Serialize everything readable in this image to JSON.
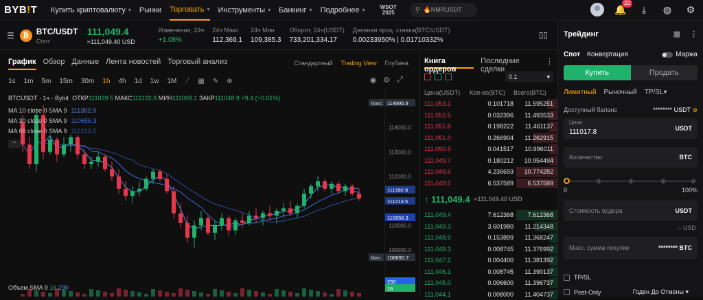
{
  "nav": {
    "logo_a": "BYB",
    "logo_b": "!",
    "logo_c": "T",
    "items": [
      {
        "label": "Купить криптовалюту",
        "chev": true
      },
      {
        "label": "Рынки",
        "chev": false
      },
      {
        "label": "Торговать",
        "chev": true,
        "active": true
      },
      {
        "label": "Инструменты",
        "chev": true
      },
      {
        "label": "Банкинг",
        "chev": true
      },
      {
        "label": "Подробнее",
        "chev": true
      }
    ],
    "wsot_a": "WSOT",
    "wsot_b": "2025",
    "search_placeholder": "🔥NMRUSDT",
    "notif_count": "22"
  },
  "ticker": {
    "pair": "BTC/USDT",
    "market": "Спот",
    "last": "111,049.4",
    "last_usd": "≈111,049.40 USD",
    "stats": [
      {
        "label": "Изменение, 24ч",
        "value": "+1.08%",
        "green": true
      },
      {
        "label": "24ч Макс",
        "value": "112,369.1"
      },
      {
        "label": "24ч Мин",
        "value": "109,385.3"
      },
      {
        "label": "Оборот, 24ч(USDT)",
        "value": "733,201,334.17"
      },
      {
        "label": "Дневная проц. ставка(BTC/USDT)",
        "value": "0.00233950% | 0.01710332%"
      }
    ]
  },
  "chart_tabs": [
    "График",
    "Обзор",
    "Данные",
    "Лента новостей",
    "Торговый анализ"
  ],
  "view_tabs": [
    "Стандартный",
    "Trading View",
    "Глубина"
  ],
  "timeframes": [
    "1s",
    "1m",
    "5m",
    "15m",
    "30m",
    "1h",
    "4h",
    "1d",
    "1w",
    "1M"
  ],
  "ohlc": {
    "symbol": "BTCUSDT · 1ч · Bybit",
    "o_l": "ОТКР",
    "o": "111039.5",
    "h_l": "МАКС",
    "h": "111132.8",
    "l_l": "МИН",
    "l": "111008.1",
    "c_l": "ЗАКР",
    "c": "111048.9",
    "chg": "+9.4 (+0.01%)"
  },
  "ma": [
    {
      "label": "MA 10 close 0 SMA 9",
      "value": "111392.9",
      "color": "#5b8def"
    },
    {
      "label": "MA 30 close 0 SMA 9",
      "value": "110656.3",
      "color": "#3a6fd8"
    },
    {
      "label": "MA 60 close 0 SMA 9",
      "value": "111213.5",
      "color": "#2d4f9a"
    }
  ],
  "volume": {
    "label": "Объем SMA 9",
    "v1": "16",
    "v2": "290",
    "tag": "290",
    "tag2": "16"
  },
  "price_axis": [
    "114000.0",
    "113000.0",
    "112000.0",
    "111000.0",
    "110000.0",
    "109000.0"
  ],
  "axis_top": "116000.0",
  "tags": {
    "max_label": "Макс.",
    "max": "114995.9",
    "min_label": "Мин.",
    "min": "108690.7",
    "t1": "111392.9",
    "t2": "111213.5",
    "t3": "110656.3"
  },
  "chart_data": {
    "type": "candlestick",
    "x": [],
    "ylim": [
      108500,
      115500
    ],
    "candles": [
      [
        114200,
        114500,
        113000,
        113300
      ],
      [
        113300,
        113600,
        112300,
        112500
      ],
      [
        112500,
        114800,
        112200,
        114500
      ],
      [
        114500,
        114900,
        112700,
        113000
      ],
      [
        113000,
        113700,
        112900,
        113500
      ],
      [
        113500,
        113600,
        112600,
        112900
      ],
      [
        112900,
        113600,
        112800,
        113300
      ],
      [
        113300,
        113700,
        113000,
        113600
      ],
      [
        113600,
        113700,
        112700,
        112900
      ],
      [
        112900,
        113100,
        112300,
        112500
      ],
      [
        112500,
        112800,
        112300,
        112600
      ],
      [
        112600,
        113000,
        112400,
        112800
      ],
      [
        112800,
        112900,
        112200,
        112300
      ],
      [
        112300,
        112600,
        111800,
        112000
      ],
      [
        112000,
        112300,
        111300,
        111500
      ],
      [
        111500,
        111800,
        111000,
        111200
      ],
      [
        111200,
        111600,
        110900,
        111400
      ],
      [
        111400,
        111800,
        111200,
        111500
      ],
      [
        111500,
        112000,
        111400,
        111900
      ],
      [
        111900,
        112300,
        111700,
        112200
      ],
      [
        112200,
        112300,
        111800,
        111900
      ],
      [
        111900,
        112100,
        111300,
        111400
      ],
      [
        111400,
        111600,
        110300,
        110500
      ],
      [
        110500,
        110900,
        109900,
        110100
      ],
      [
        110100,
        110400,
        109300,
        109500
      ],
      [
        109500,
        110200,
        109100,
        110000
      ],
      [
        110000,
        110600,
        109800,
        110300
      ],
      [
        110300,
        110400,
        109600,
        109700
      ],
      [
        109700,
        110200,
        109400,
        110000
      ],
      [
        110000,
        110500,
        109800,
        110300
      ],
      [
        110300,
        110400,
        109600,
        109800
      ],
      [
        109800,
        110300,
        109600,
        110200
      ],
      [
        110200,
        110500,
        109900,
        110100
      ],
      [
        110100,
        110600,
        110000,
        110400
      ],
      [
        110400,
        110700,
        110100,
        110300
      ],
      [
        110300,
        110600,
        110000,
        110500
      ],
      [
        110500,
        110800,
        110200,
        110400
      ],
      [
        110400,
        110700,
        110100,
        110600
      ],
      [
        110600,
        110900,
        110300,
        110700
      ],
      [
        110700,
        111000,
        110400,
        110500
      ],
      [
        110500,
        110900,
        110300,
        110800
      ],
      [
        110800,
        111500,
        110700,
        111300
      ],
      [
        111300,
        111700,
        111100,
        111600
      ],
      [
        111600,
        112000,
        111400,
        111800
      ],
      [
        111800,
        111900,
        111400,
        111500
      ],
      [
        111500,
        111800,
        111300,
        111700
      ],
      [
        111700,
        111800,
        111300,
        111400
      ],
      [
        111400,
        111700,
        111200,
        111600
      ],
      [
        111600,
        111700,
        111200,
        111300
      ],
      [
        111300,
        111500,
        111000,
        111100
      ]
    ]
  },
  "orderbook": {
    "tab1": "Книга ордеров",
    "tab2": "Последние сделки",
    "tick": "0.1",
    "h_price": "Цена(USDT)",
    "h_qty": "Кол-во(BTC)",
    "h_total": "Всего(BTC)",
    "asks": [
      {
        "p": "111,053.1",
        "q": "0.101718",
        "t": "11.595251",
        "w": 0.25
      },
      {
        "p": "111,052.6",
        "q": "0.032396",
        "t": "11.493533",
        "w": 0.22
      },
      {
        "p": "111,051.8",
        "q": "0.198222",
        "t": "11.461137",
        "w": 0.22
      },
      {
        "p": "111,051.0",
        "q": "0.266904",
        "t": "11.262915",
        "w": 0.6
      },
      {
        "p": "111,050.9",
        "q": "0.041517",
        "t": "10.996011",
        "w": 0.2
      },
      {
        "p": "111,049.7",
        "q": "0.180212",
        "t": "10.954494",
        "w": 0.2
      },
      {
        "p": "111,049.6",
        "q": "4.236693",
        "t": "10.774282",
        "w": 1
      },
      {
        "p": "111,049.5",
        "q": "6.537589",
        "t": "6.537589",
        "w": 1
      }
    ],
    "mid": "↑ 111,049.4",
    "mid_usd": "≈111,049.40 USD",
    "bids": [
      {
        "p": "111,049.4",
        "q": "7.612368",
        "t": "7.612368",
        "w": 1
      },
      {
        "p": "111,049.3",
        "q": "3.601980",
        "t": "11.214348",
        "w": 0.55
      },
      {
        "p": "111,048.9",
        "q": "0.153899",
        "t": "11.368247",
        "w": 0.2
      },
      {
        "p": "111,048.3",
        "q": "0.008745",
        "t": "11.376992",
        "w": 0.2
      },
      {
        "p": "111,047.2",
        "q": "0.004400",
        "t": "11.381392",
        "w": 0.2
      },
      {
        "p": "111,046.1",
        "q": "0.008745",
        "t": "11.390137",
        "w": 0.2
      },
      {
        "p": "111,045.0",
        "q": "0.006600",
        "t": "11.396737",
        "w": 0.2
      },
      {
        "p": "111,044.1",
        "q": "0.008000",
        "t": "11.404737",
        "w": 0.2
      }
    ]
  },
  "trade": {
    "title": "Трейдинг",
    "spot": "Спот",
    "convert": "Конвертация",
    "margin": "Маржа",
    "buy": "Купить",
    "sell": "Продать",
    "types": [
      "Лимитный",
      "Рыночный",
      "TP/SL"
    ],
    "avail_label": "Доступный баланс",
    "avail_val": "******** USDT",
    "price_label": "Цена",
    "price_val": "111017.8",
    "unit_usdt": "USDT",
    "qty_ph": "Количество",
    "unit_btc": "BTC",
    "s0": "0",
    "s100": "100%",
    "cost_ph": "Стоимость ордера",
    "usd": "-- USD",
    "maxbuy": "Макс. сумма покупки",
    "maxbuy_val": "******** BTC",
    "tpsl": "TP/SL",
    "postonly": "Post-Only",
    "gtc": "Годен До Отмены"
  }
}
